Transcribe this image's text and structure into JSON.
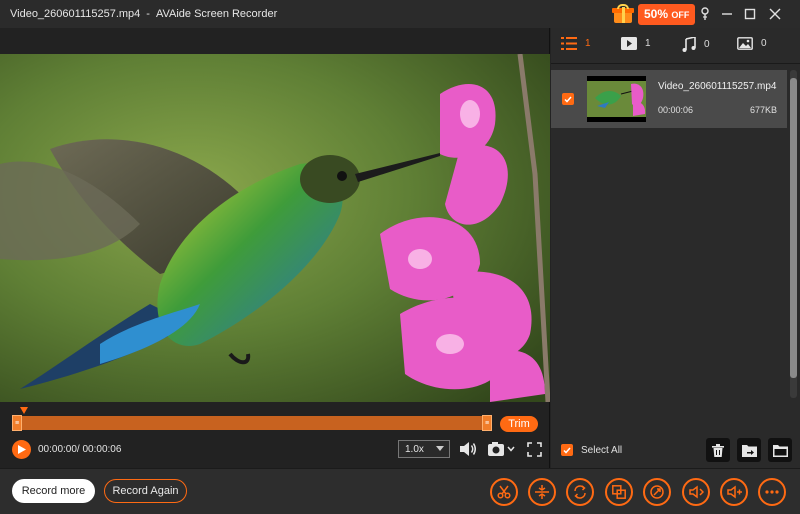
{
  "window": {
    "file_title": "Video_260601115257.mp4",
    "separator": "-",
    "app_title": "AVAide Screen Recorder"
  },
  "promo": {
    "percent": "50%",
    "off": "OFF"
  },
  "player": {
    "time": "00:00:00/ 00:00:06",
    "speed": "1.0x",
    "trim_label": "Trim"
  },
  "tabs": [
    {
      "name": "list",
      "count": "1"
    },
    {
      "name": "video",
      "count": "1"
    },
    {
      "name": "audio",
      "count": "0"
    },
    {
      "name": "image",
      "count": "0"
    }
  ],
  "file": {
    "name": "Video_260601115257.mp4",
    "duration": "00:00:06",
    "size": "677KB"
  },
  "select_all": "Select All",
  "bottom": {
    "record_more": "Record more",
    "record_again": "Record Again"
  },
  "colors": {
    "accent": "#ff6a13",
    "background": "#232323"
  },
  "icons": [
    "gift-icon",
    "pin-icon",
    "minimize-icon",
    "maximize-icon",
    "close-icon",
    "play-icon",
    "volume-icon",
    "camera-icon",
    "fullscreen-icon",
    "trash-icon",
    "export-icon",
    "folder-icon",
    "scissors-icon",
    "advanced-trimmer-icon",
    "converter-icon",
    "merger-icon",
    "compressor-icon",
    "audio-record-icon",
    "volume-boost-icon",
    "more-icon"
  ]
}
